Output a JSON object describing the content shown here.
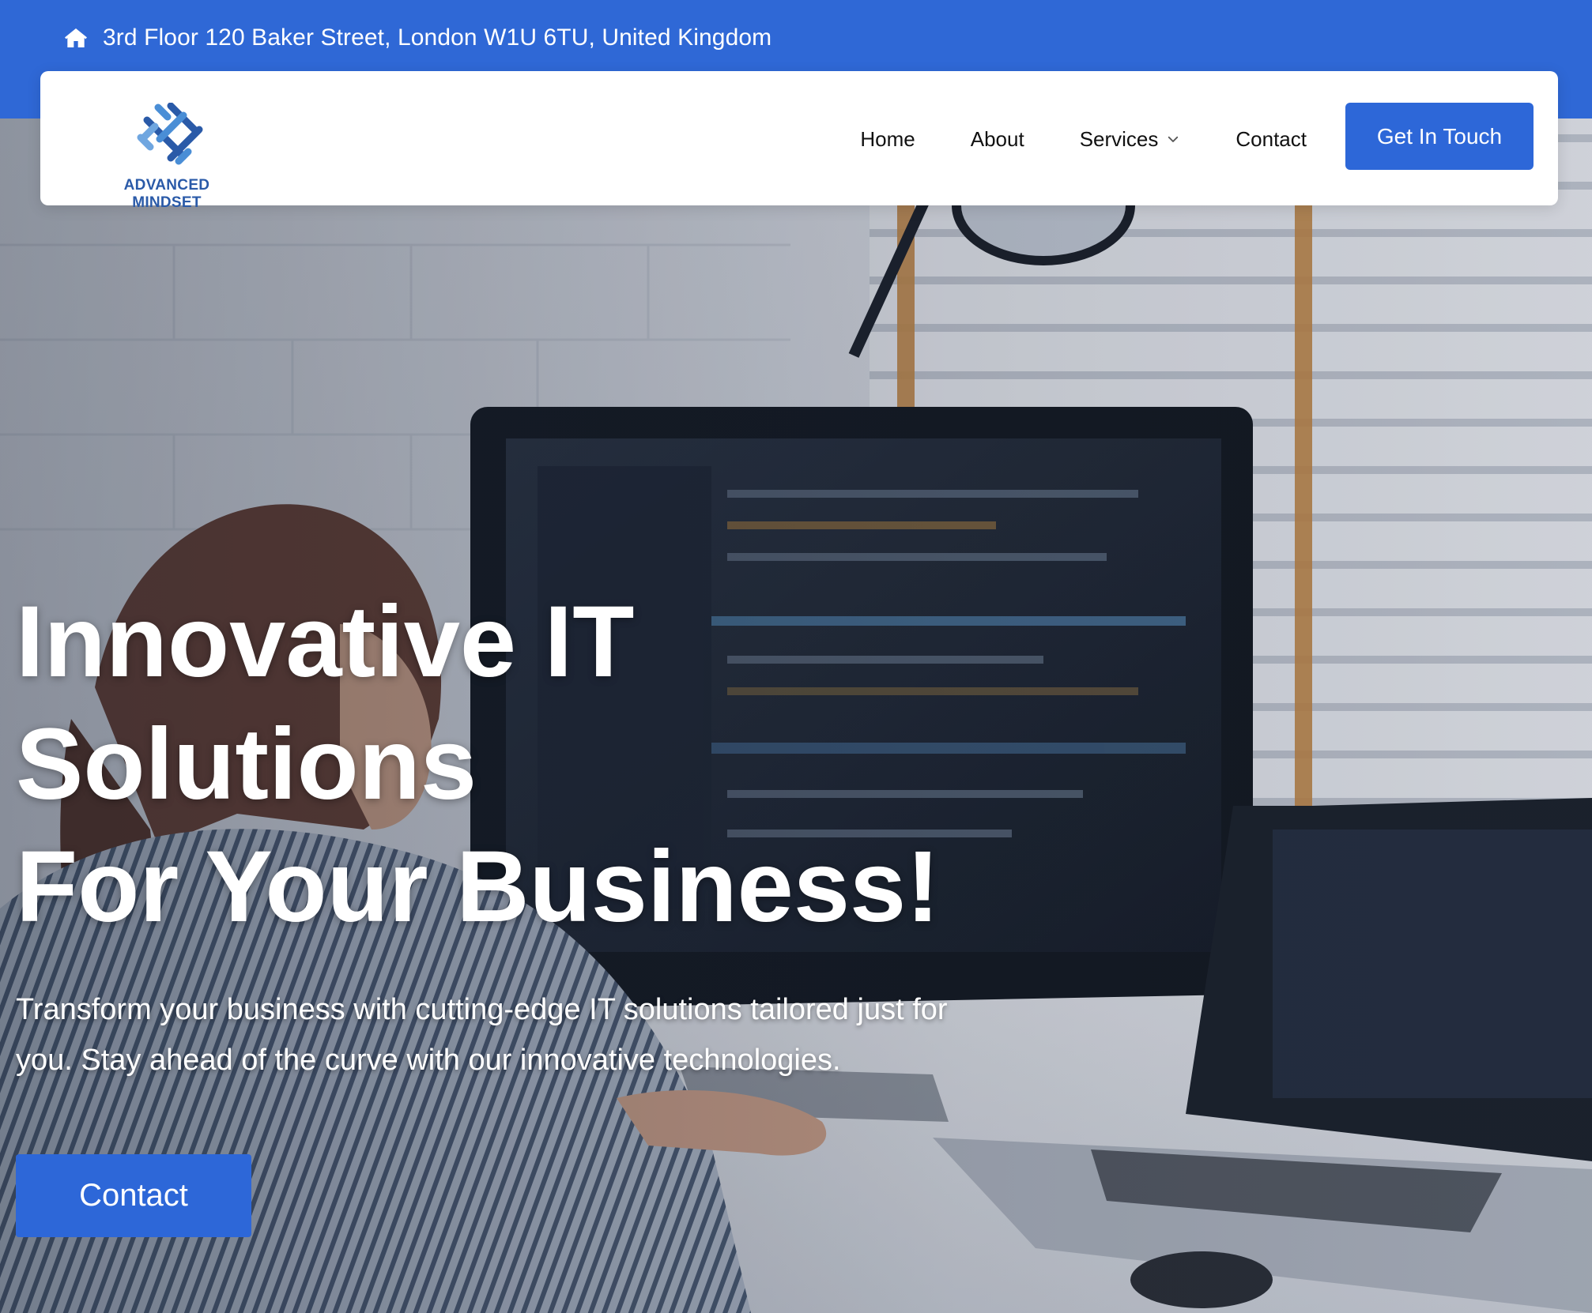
{
  "topbar": {
    "icon": "home-icon",
    "address": "3rd Floor 120 Baker Street, London W1U 6TU, United Kingdom"
  },
  "brand": {
    "name": "ADVANCED MINDSET",
    "color": "#2a5aa8"
  },
  "nav": {
    "items": [
      {
        "label": "Home"
      },
      {
        "label": "About"
      },
      {
        "label": "Services",
        "icon": "chevron-down-icon"
      },
      {
        "label": "Contact"
      }
    ],
    "cta_label": "Get In Touch"
  },
  "hero": {
    "title_lines": [
      "Innovative IT",
      "Solutions",
      "For Your Business!"
    ],
    "subtitle": "Transform your business with cutting-edge IT solutions tailored just for you. Stay ahead of the curve with our innovative technologies.",
    "button_label": "Contact"
  },
  "colors": {
    "accent": "#2f68d6",
    "button": "#2d67d8",
    "text_light": "#ffffff"
  }
}
